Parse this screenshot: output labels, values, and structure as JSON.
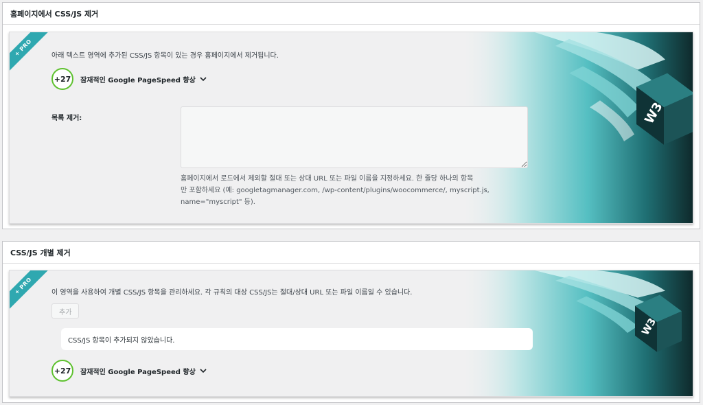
{
  "section1": {
    "title": "홈페이지에서 CSS/JS 제거",
    "ribbon": "+ PRO",
    "description": "아래 텍스트 영역에 추가된 CSS/JS 항목이 있는 경우 홈페이지에서 제거됩니다.",
    "impact_value": "+27",
    "impact_label": "잠재적인 Google PageSpeed 향상",
    "field_label": "목록 제거:",
    "textarea_value": "",
    "help_line1": "홈페이지에서 로드에서 제외할 절대 또는 상대 URL 또는 파일 이름을 지정하세요. 한 줄당 하나의 항목",
    "help_line2": "만 포함하세요 (예: googletagmanager.com, /wp-content/plugins/woocommerce/, myscript.js,",
    "help_line3": "name=\"myscript\" 등)."
  },
  "section2": {
    "title": "CSS/JS 개별 제거",
    "ribbon": "+ PRO",
    "description": "이 영역을 사용하여 개별 CSS/JS 항목을 관리하세요. 각 규칙의 대상 CSS/JS는 절대/상대 URL 또는 파일 이름일 수 있습니다.",
    "add_button": "추가",
    "empty_message": "CSS/JS 항목이 추가되지 않았습니다.",
    "impact_value": "+27",
    "impact_label": "잠재적인 Google PageSpeed 향상"
  },
  "colors": {
    "accent_teal": "#2fa8b0",
    "badge_green": "#5ec12f",
    "dark_teal": "#0f2a2c"
  },
  "icons": {
    "impact_chevron": "chevron-down-icon",
    "logo": "w3-cube-logo"
  }
}
